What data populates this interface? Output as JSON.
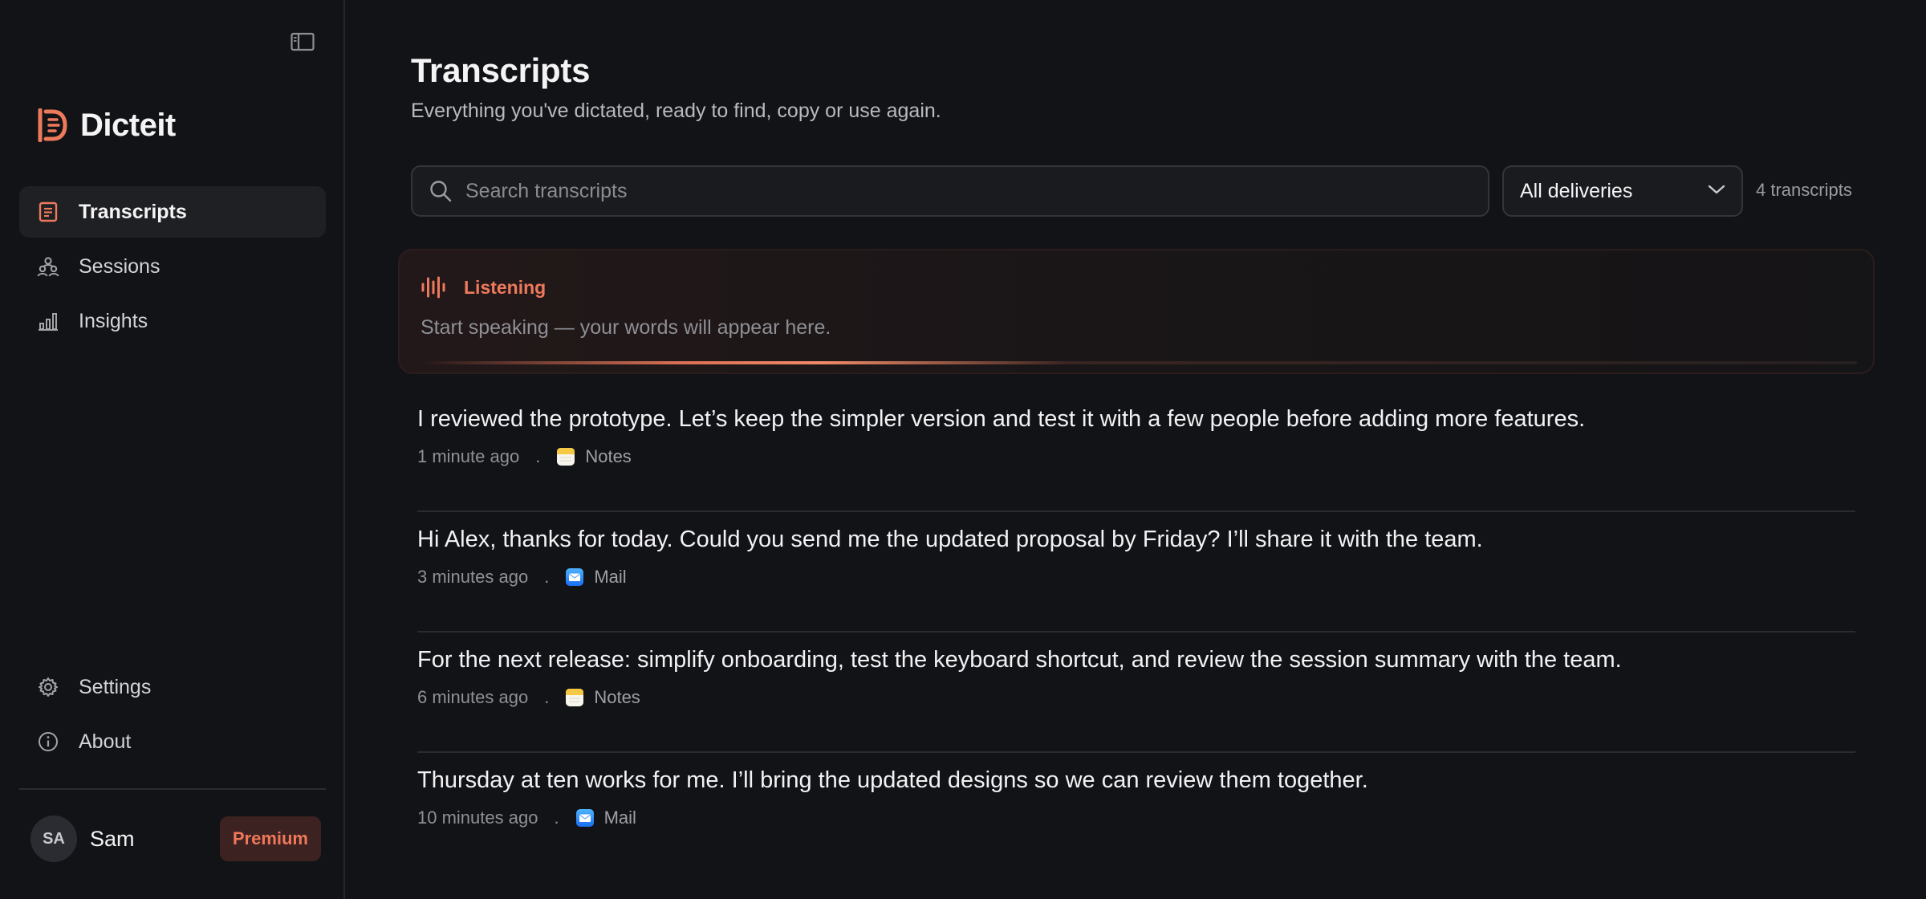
{
  "sidebar": {
    "brand": "Dicteit",
    "nav": [
      {
        "label": "Transcripts",
        "icon": "document-icon",
        "active": true
      },
      {
        "label": "Sessions",
        "icon": "people-icon",
        "active": false
      },
      {
        "label": "Insights",
        "icon": "bar-chart-icon",
        "active": false
      }
    ],
    "bottom_nav": [
      {
        "label": "Settings",
        "icon": "gear-icon"
      },
      {
        "label": "About",
        "icon": "info-icon"
      }
    ],
    "user": {
      "initials": "SA",
      "name": "Sam",
      "badge": "Premium"
    }
  },
  "main": {
    "title": "Transcripts",
    "subtitle": "Everything you've dictated, ready to find, copy or use again.",
    "search": {
      "placeholder": "Search transcripts",
      "value": ""
    },
    "filter": {
      "selected": "All deliveries"
    },
    "count": "4 transcripts",
    "listening": {
      "label": "Listening",
      "hint": "Start speaking — your words will appear here."
    },
    "separator": ".",
    "transcripts": [
      {
        "text": "I reviewed the prototype. Let’s keep the simpler version and test it with a few people before adding more features.",
        "time": "1 minute ago",
        "app": "Notes"
      },
      {
        "text": "Hi Alex, thanks for today. Could you send me the updated proposal by Friday? I’ll share it with the team.",
        "time": "3 minutes ago",
        "app": "Mail"
      },
      {
        "text": "For the next release: simplify onboarding, test the keyboard shortcut, and review the session summary with the team.",
        "time": "6 minutes ago",
        "app": "Notes"
      },
      {
        "text": "Thursday at ten works for me. I’ll bring the updated designs so we can review them together.",
        "time": "10 minutes ago",
        "app": "Mail"
      }
    ]
  },
  "colors": {
    "accent": "#ee7a5c",
    "background": "#121316",
    "sidebar_active": "#1f2024",
    "premium_bg": "#3c2220"
  }
}
